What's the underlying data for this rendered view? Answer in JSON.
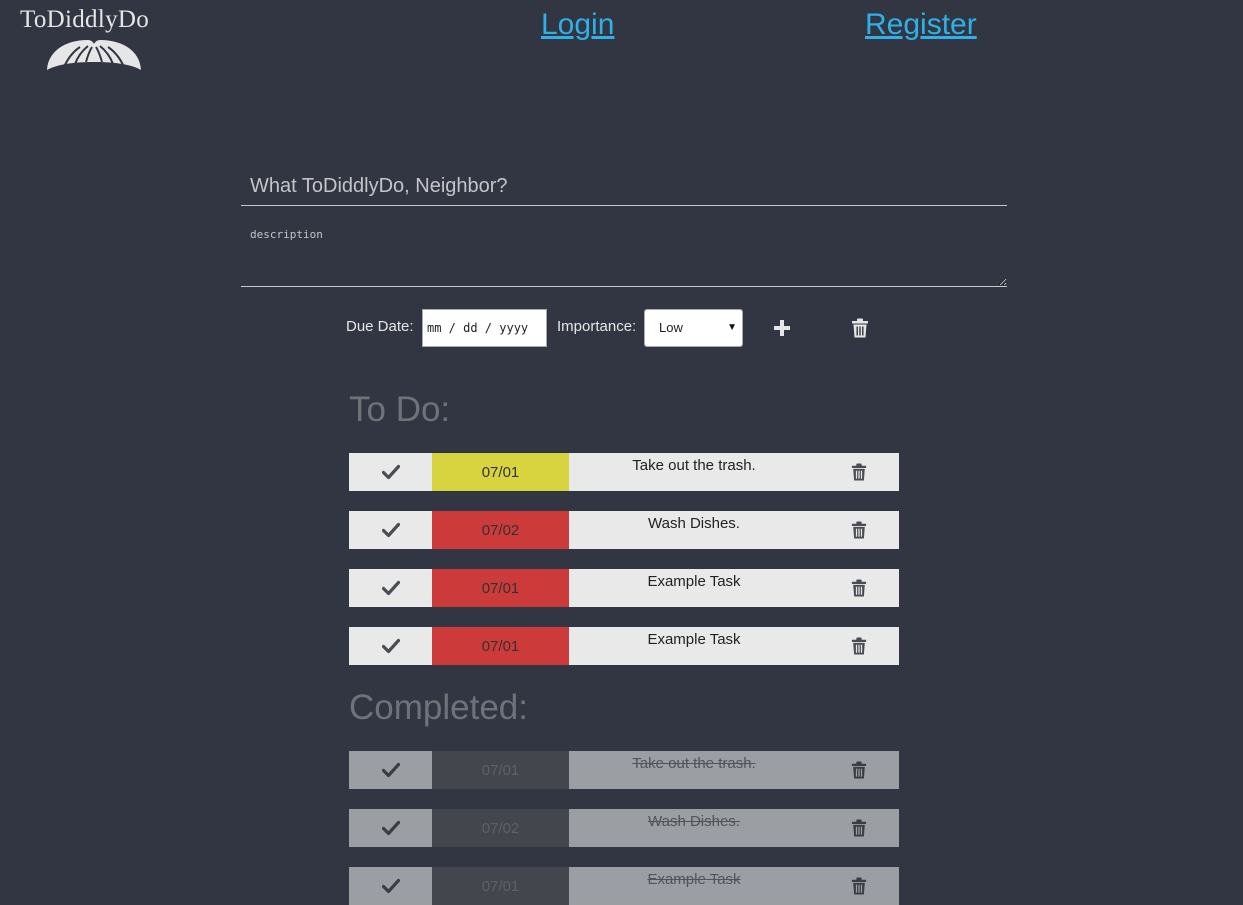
{
  "brand": {
    "logo_text": "ToDiddlyDo",
    "logo_icon": "mustache-icon"
  },
  "nav": {
    "login": "Login",
    "register": "Register"
  },
  "form": {
    "title_placeholder": "What ToDiddlyDo, Neighbor?",
    "description_placeholder": "description",
    "due_date_label": "Due Date:",
    "due_date_placeholder": "mm / dd / yyyy",
    "importance_label": "Importance:",
    "importance_value": "Low",
    "add_icon": "plus-icon",
    "clear_icon": "trash-icon"
  },
  "todo": {
    "heading": "To Do:",
    "tasks": [
      {
        "date": "07/01",
        "name": "Take out the trash.",
        "priority_color": "#d8d440"
      },
      {
        "date": "07/02",
        "name": "Wash Dishes.",
        "priority_color": "#cc3a3a"
      },
      {
        "date": "07/01",
        "name": "Example Task",
        "priority_color": "#cc3a3a"
      },
      {
        "date": "07/01",
        "name": "Example Task",
        "priority_color": "#cc3a3a"
      }
    ]
  },
  "completed": {
    "heading": "Completed:",
    "tasks": [
      {
        "date": "07/01",
        "name": "Take out the trash."
      },
      {
        "date": "07/02",
        "name": "Wash Dishes."
      },
      {
        "date": "07/01",
        "name": "Example Task"
      }
    ]
  },
  "colors": {
    "background": "#313642",
    "link": "#2fb0e6",
    "row": "#e8e9e8",
    "row_completed": "#9b9ea3",
    "date_completed": "#43464c",
    "priority_high": "#cc3a3a",
    "priority_medium": "#d8d440"
  }
}
